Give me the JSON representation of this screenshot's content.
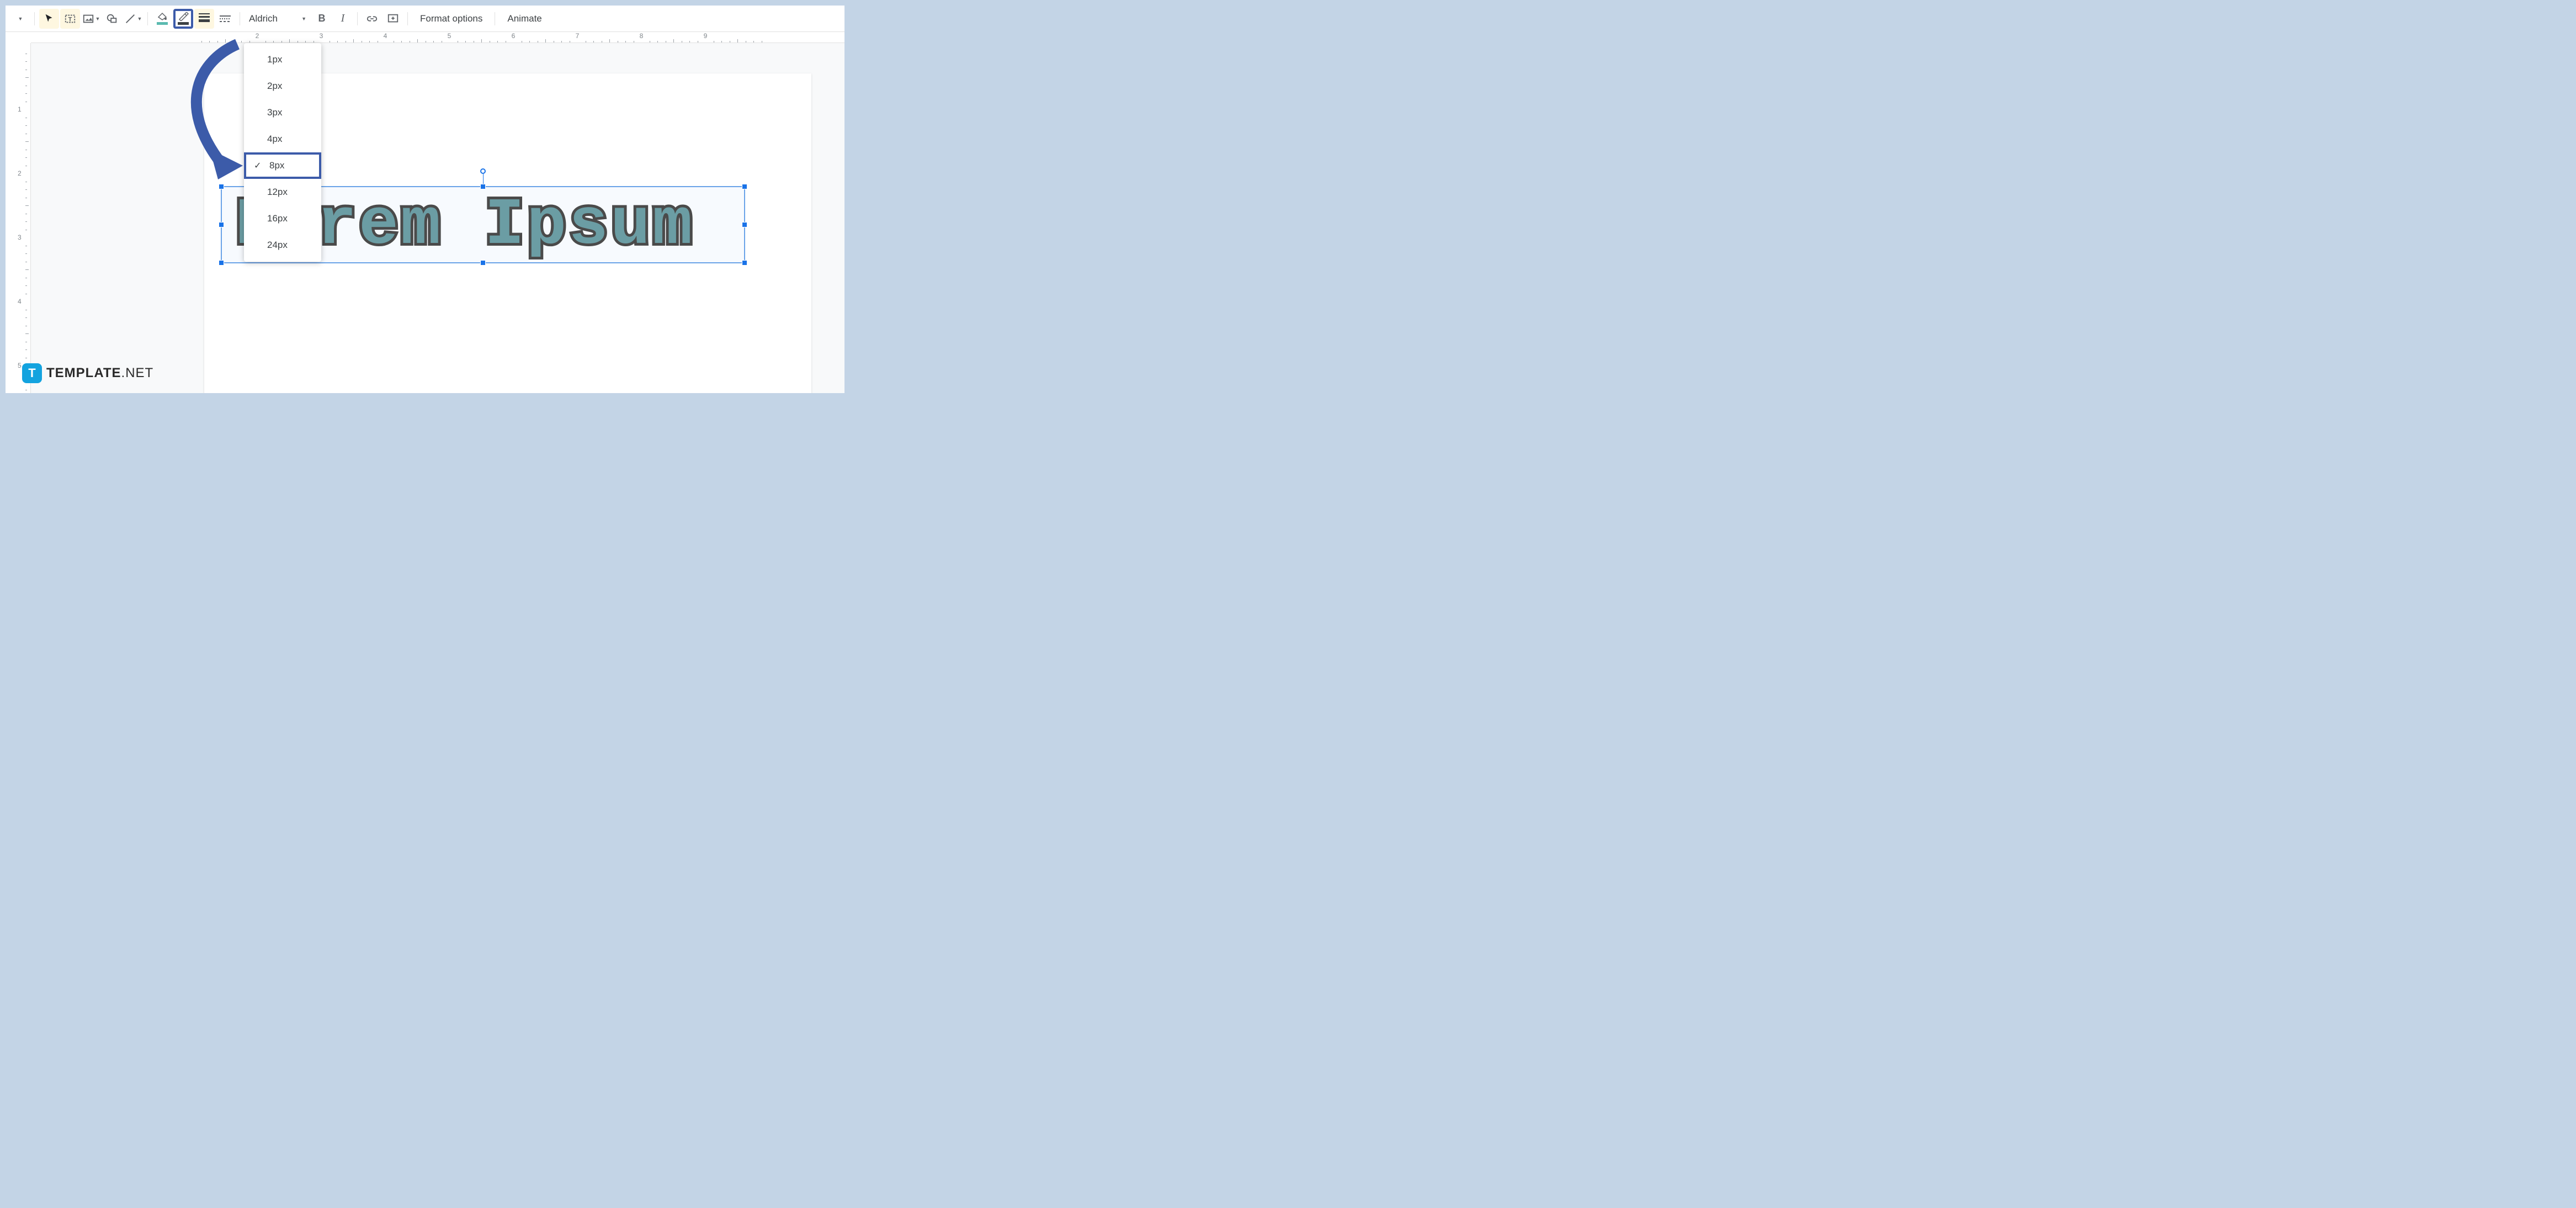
{
  "toolbar": {
    "font_name": "Aldrich",
    "format_options": "Format options",
    "animate": "Animate"
  },
  "weight_menu": {
    "options": [
      "1px",
      "2px",
      "3px",
      "4px",
      "8px",
      "12px",
      "16px",
      "24px"
    ],
    "selected": "8px"
  },
  "ruler_h": {
    "numbers": [
      2,
      3,
      4,
      5,
      6,
      7,
      8,
      9
    ]
  },
  "ruler_v": {
    "numbers": [
      1,
      2,
      3,
      4,
      5
    ]
  },
  "canvas": {
    "word_art_text": "Lorem Ipsum"
  },
  "watermark": {
    "icon_letter": "T",
    "text_bold": "TEMPLATE",
    "text_light": ".NET"
  },
  "colors": {
    "highlight_border": "#3c5ba9",
    "accent": "#1a73e8",
    "teal_underline": "#5bbab0"
  }
}
